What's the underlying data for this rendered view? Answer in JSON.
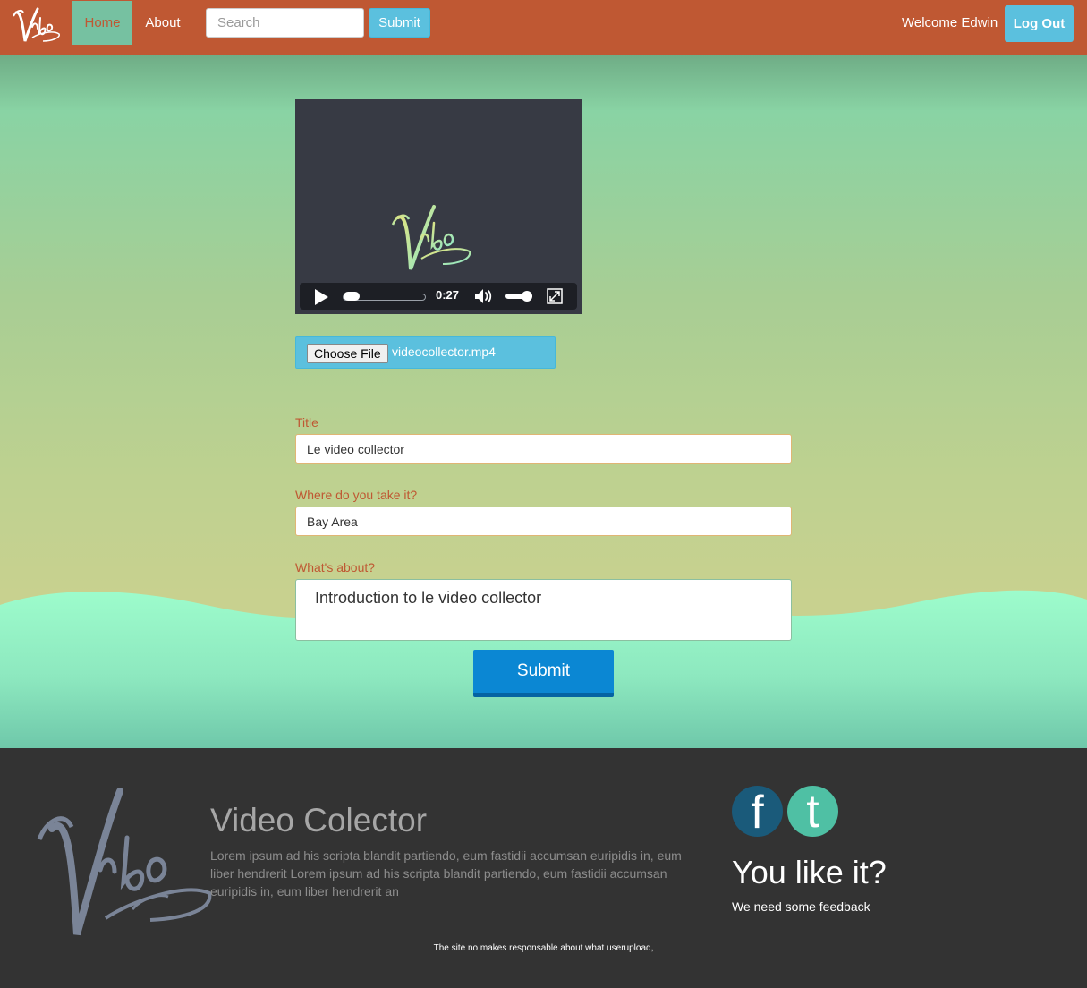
{
  "nav": {
    "home": "Home",
    "about": "About",
    "search_placeholder": "Search",
    "submit": "Submit",
    "welcome": "Welcome Edwin",
    "logout": "Log Out"
  },
  "video": {
    "time": "0:27",
    "progress_fraction": 0.0
  },
  "upload": {
    "choose_file": "Choose File",
    "file_name": "videocollector.mp4"
  },
  "form": {
    "title_label": "Title",
    "title_value": "Le video collector",
    "where_label": "Where do you take it?",
    "where_value": "Bay Area",
    "about_label": "What's about?",
    "about_value": "Introduction to le video collector",
    "submit": "Submit"
  },
  "footer": {
    "title": "Video Colector",
    "description": "Lorem ipsum ad his scripta blandit partiendo, eum fastidii accumsan euripidis in, eum liber hendrerit Lorem ipsum ad his scripta blandit partiendo, eum fastidii accumsan euripidis in, eum liber hendrerit an",
    "facebook_glyph": "f",
    "twitter_glyph": "t",
    "like_title": "You like it?",
    "like_sub": "We need some feedback",
    "disclaimer": "The site no makes responsable about what userupload,"
  },
  "colors": {
    "navbar": "#bf5833",
    "accent": "#5bc0de",
    "active_nav": "#76c1a1",
    "primary_button": "#0b87d3",
    "footer": "#333333"
  }
}
